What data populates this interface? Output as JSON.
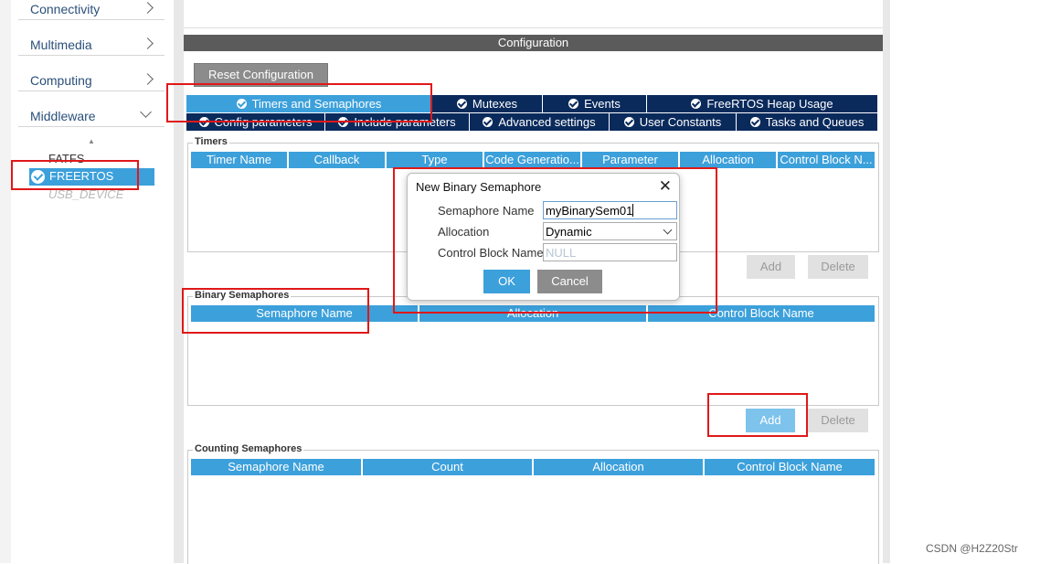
{
  "sidebar": {
    "categories": [
      {
        "label": "Connectivity"
      },
      {
        "label": "Multimedia"
      },
      {
        "label": "Computing"
      },
      {
        "label": "Middleware"
      }
    ],
    "middleware_items": [
      "FATFS",
      "FREERTOS",
      "USB_DEVICE"
    ]
  },
  "configuration": {
    "title": "Configuration",
    "reset_label": "Reset Configuration",
    "tabs_row1": [
      "Timers and Semaphores",
      "Mutexes",
      "Events",
      "FreeRTOS Heap Usage"
    ],
    "tabs_row2": [
      "Config parameters",
      "Include parameters",
      "Advanced settings",
      "User Constants",
      "Tasks and Queues"
    ]
  },
  "timers": {
    "title": "Timers",
    "columns": [
      "Timer Name",
      "Callback",
      "Type",
      "Code Generatio...",
      "Parameter",
      "Allocation",
      "Control Block N..."
    ],
    "add_label": "Add",
    "delete_label": "Delete"
  },
  "binary_semaphores": {
    "title": "Binary Semaphores",
    "columns": [
      "Semaphore Name",
      "Allocation",
      "Control Block Name"
    ],
    "add_label": "Add",
    "delete_label": "Delete"
  },
  "counting_semaphores": {
    "title": "Counting Semaphores",
    "columns": [
      "Semaphore Name",
      "Count",
      "Allocation",
      "Control Block Name"
    ]
  },
  "dialog": {
    "title": "New Binary Semaphore",
    "name_label": "Semaphore Name",
    "name_value": "myBinarySem01",
    "allocation_label": "Allocation",
    "allocation_value": "Dynamic",
    "cb_label": "Control Block Name",
    "cb_placeholder": "NULL",
    "ok_label": "OK",
    "cancel_label": "Cancel"
  },
  "watermark": "CSDN @H2Z20Str",
  "colors": {
    "accent": "#3ca0db",
    "tab_dark": "#0a2a5c",
    "highlight": "#e01818"
  }
}
